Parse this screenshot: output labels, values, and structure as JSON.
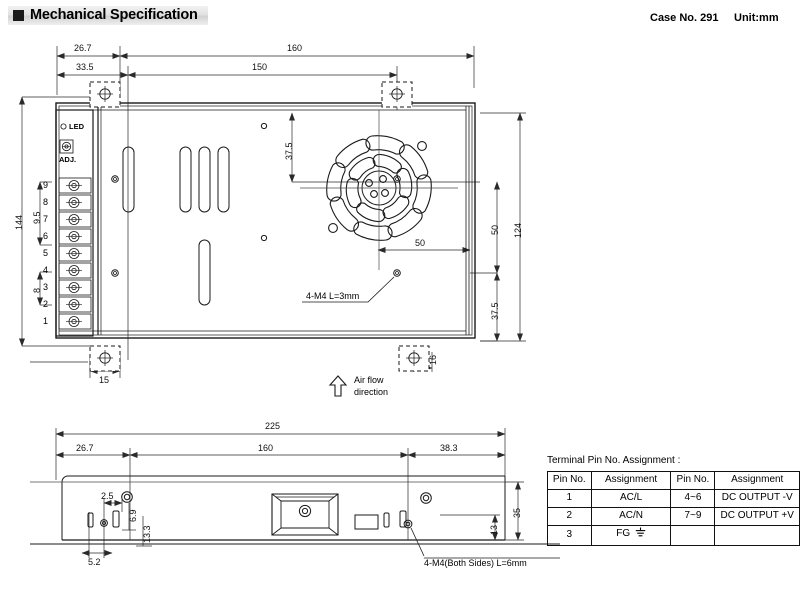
{
  "header": {
    "title": "Mechanical Specification",
    "case_no": "Case No. 291",
    "unit": "Unit:mm"
  },
  "top_view": {
    "dimensions": {
      "d_26_7": "26.7",
      "d_160": "160",
      "d_33_5": "33.5",
      "d_150": "150",
      "d_144": "144",
      "d_9_5": "9.5",
      "d_8": "8",
      "d_37_5_top": "37.5",
      "d_50_vert": "50",
      "d_124": "124",
      "d_50_horiz": "50",
      "d_37_5_bottom": "37.5",
      "d_15": "15",
      "d_16": "16"
    },
    "annotations": {
      "screw_note": "4-M4 L=3mm",
      "airflow_line1": "Air flow",
      "airflow_line2": "direction",
      "led_label": "LED",
      "adj_label": "ADJ."
    },
    "terminal_pin_numbers": [
      "9",
      "8",
      "7",
      "6",
      "5",
      "4",
      "3",
      "2",
      "1"
    ]
  },
  "side_view": {
    "dimensions": {
      "d_225": "225",
      "d_26_7": "26.7",
      "d_160": "160",
      "d_38_3": "38.3",
      "d_2_5": "2.5",
      "d_6_9": "6.9",
      "d_13_3": "13.3",
      "d_5_2": "5.2",
      "d_35": "35",
      "d_13": "13"
    },
    "annotations": {
      "screw_note": "4-M4(Both Sides) L=6mm"
    }
  },
  "pin_table": {
    "caption": "Terminal Pin No. Assignment :",
    "headers": [
      "Pin No.",
      "Assignment",
      "Pin No.",
      "Assignment"
    ],
    "rows": [
      {
        "pin_a": "1",
        "assign_a": "AC/L",
        "pin_b": "4~6",
        "assign_b": "DC OUTPUT -V"
      },
      {
        "pin_a": "2",
        "assign_a": "AC/N",
        "pin_b": "7~9",
        "assign_b": "DC OUTPUT +V"
      },
      {
        "pin_a": "3",
        "assign_a": "FG",
        "pin_b": "",
        "assign_b": ""
      }
    ],
    "fg_symbol": "ground-symbol"
  },
  "colors": {
    "line": "#1a1a1a",
    "dim_line": "#3a3a3a",
    "header_band": "#e2e2e2",
    "text": "#000000"
  }
}
